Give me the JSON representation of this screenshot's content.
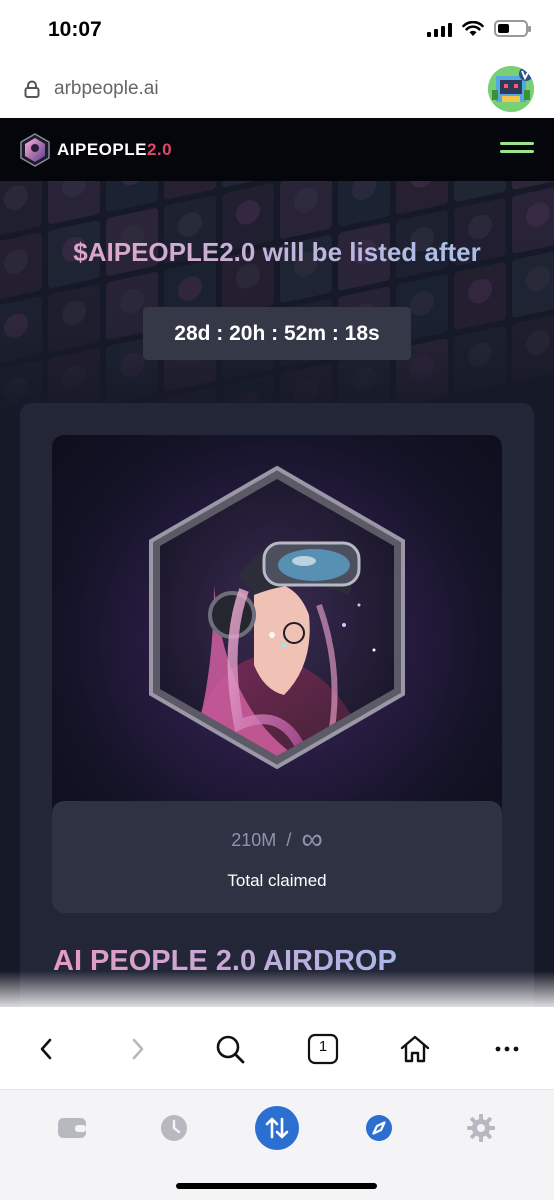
{
  "status_bar": {
    "time": "10:07"
  },
  "url_bar": {
    "url": "arbpeople.ai"
  },
  "site_header": {
    "logo_main": "AIPEOPLE",
    "logo_accent": "2.0"
  },
  "hero": {
    "listed_title": "$AIPEOPLE2.0 will be listed after",
    "countdown": "28d : 20h : 52m : 18s"
  },
  "card": {
    "claimed_amount": "210M",
    "claimed_separator": "/",
    "claimed_total_symbol": "∞",
    "claimed_label": "Total claimed"
  },
  "section": {
    "airdrop_title": "AI PEOPLE 2.0 AIRDROP"
  },
  "browser_toolbar": {
    "tab_count": "1"
  },
  "colors": {
    "header_bg": "#05060b",
    "hero_bg": "#161927",
    "card_bg": "#232636",
    "logo_accent": "#e0456a",
    "menu_accent": "#9be38d",
    "wallet_accent": "#2b6fd0"
  },
  "icons": {
    "lock": "lock-icon",
    "menu": "hamburger-menu-icon",
    "back": "chevron-left-icon",
    "forward": "chevron-right-icon",
    "search": "search-icon",
    "tabs": "tabs-icon",
    "home": "home-icon",
    "more": "more-icon",
    "wallet": "wallet-icon",
    "history": "clock-icon",
    "swap": "swap-icon",
    "browser": "compass-icon",
    "settings": "gear-icon"
  }
}
